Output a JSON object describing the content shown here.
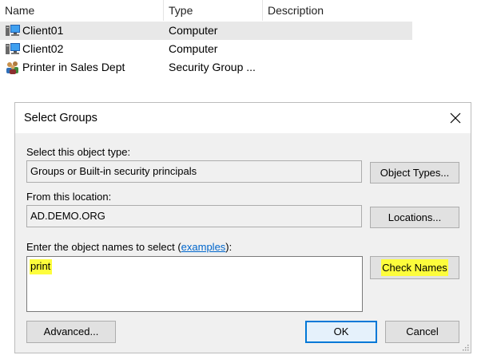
{
  "list": {
    "columns": [
      "Name",
      "Type",
      "Description"
    ],
    "rows": [
      {
        "name": "Client01",
        "type": "Computer",
        "icon": "computer-icon",
        "selected": true
      },
      {
        "name": "Client02",
        "type": "Computer",
        "icon": "computer-icon",
        "selected": false
      },
      {
        "name": "Printer in Sales Dept",
        "type": "Security Group ...",
        "icon": "group-icon",
        "selected": false
      }
    ]
  },
  "dialog": {
    "title": "Select Groups",
    "object_type_label": "Select this object type:",
    "object_type_value": "Groups or Built-in security principals",
    "object_types_button": "Object Types...",
    "location_label": "From this location:",
    "location_value": "AD.DEMO.ORG",
    "locations_button": "Locations...",
    "names_label_prefix": "Enter the object names to select (",
    "names_label_link": "examples",
    "names_label_suffix": "):",
    "names_value": "print",
    "check_names_button": "Check Names",
    "advanced_button": "Advanced...",
    "ok_button": "OK",
    "cancel_button": "Cancel"
  },
  "colors": {
    "highlight": "#fdfd3c",
    "link": "#0066cc",
    "selected_row": "#e8e8e8",
    "default_button_border": "#0078d7"
  }
}
